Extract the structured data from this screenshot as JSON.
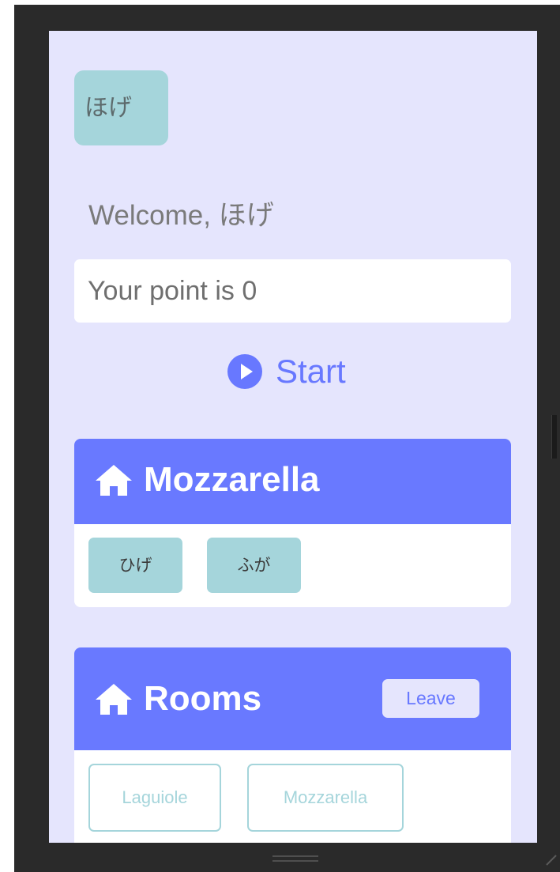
{
  "user": {
    "chip_label": "ほげ",
    "welcome_prefix": "Welcome, ",
    "welcome_name": "ほげ"
  },
  "points": {
    "text": "Your point is 0"
  },
  "start": {
    "label": "Start",
    "icon": "play-circle-icon"
  },
  "current_room": {
    "title": "Mozzarella",
    "icon": "home-icon",
    "members": [
      "ひげ",
      "ふが"
    ]
  },
  "rooms": {
    "title": "Rooms",
    "icon": "home-icon",
    "leave_label": "Leave",
    "list": [
      "Laguiole",
      "Mozzarella"
    ]
  },
  "colors": {
    "screen_bg": "#e5e5fd",
    "accent": "#6979ff",
    "chip": "#a5d5db",
    "frame": "#2a2a2a"
  }
}
